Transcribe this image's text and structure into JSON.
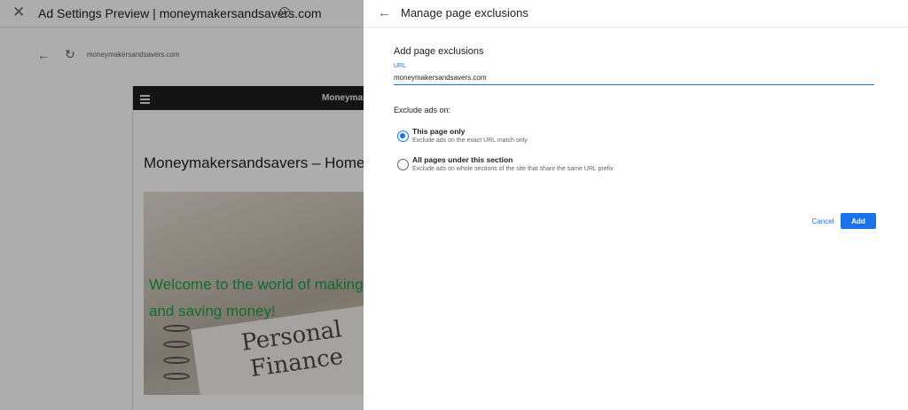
{
  "background": {
    "window_title": "Ad Settings Preview | moneymakersandsavers.com",
    "close_glyph": "✕",
    "info_glyph": "i",
    "back_glyph": "←",
    "reload_glyph": "↻",
    "preview_url": "moneymakersandsavers.com",
    "site": {
      "brand": "Moneymakersandsavers",
      "heading": "Moneymakersandsavers – Home",
      "hero_text": "Welcome to the world of making and saving money!",
      "hero_image_words": [
        "Personal",
        "Finance"
      ]
    }
  },
  "panel": {
    "back_glyph": "←",
    "title": "Manage page exclusions",
    "section_title": "Add page exclusions",
    "url_label": "URL",
    "url_value": "moneymakersandsavers.com",
    "exclude_label": "Exclude ads on:",
    "options": [
      {
        "title": "This page only",
        "description": "Exclude ads on the exact URL match only",
        "selected": true
      },
      {
        "title": "All pages under this section",
        "description": "Exclude ads on whole sections of the site that share the same URL prefix",
        "selected": false
      }
    ],
    "cancel_label": "Cancel",
    "add_label": "Add"
  },
  "colors": {
    "accent": "#1a73e8",
    "hero_text": "#19a04b",
    "site_nav": "#1e1e1e",
    "overlay": "rgba(0,0,0,0.32)"
  }
}
